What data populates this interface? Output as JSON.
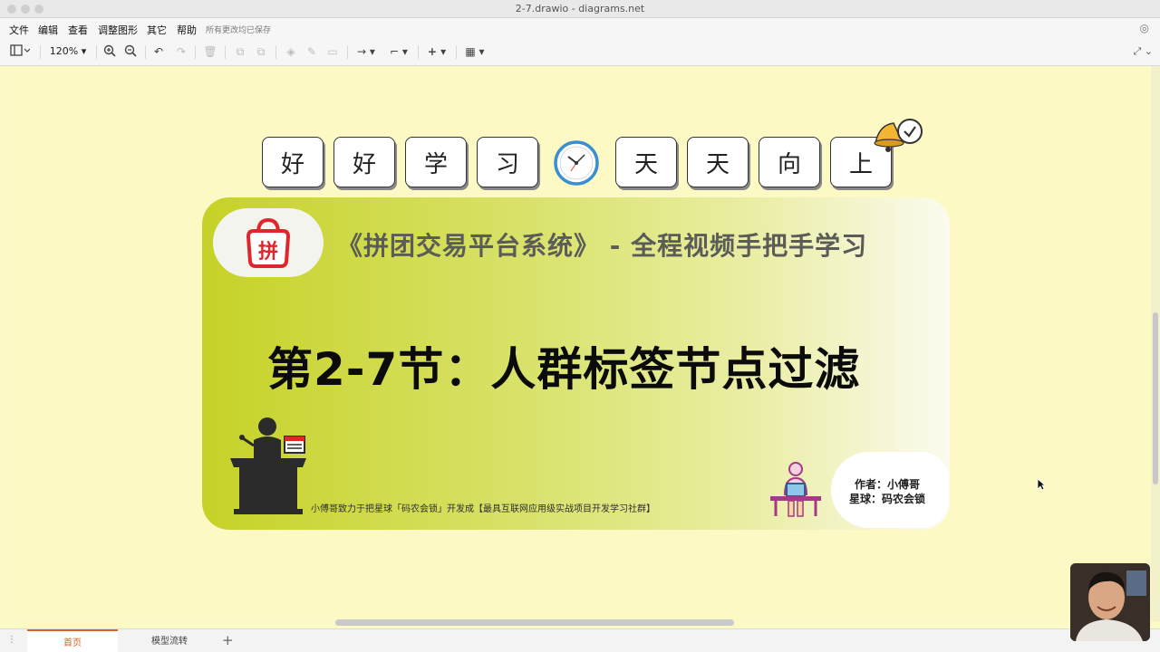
{
  "window": {
    "title": "2-7.drawio - diagrams.net"
  },
  "menubar": {
    "items": [
      "文件",
      "编辑",
      "查看",
      "调整图形",
      "其它",
      "帮助"
    ],
    "status": "所有更改均已保存"
  },
  "toolbar": {
    "zoom": "120%"
  },
  "canvas": {
    "chars_left": [
      "好",
      "好",
      "学",
      "习"
    ],
    "chars_right": [
      "天",
      "天",
      "向",
      "上"
    ],
    "logo_text": "拼",
    "course_title": "《拼团交易平台系统》 - 全程视频手把手学习",
    "lesson_title": "第2-7节：人群标签节点过滤",
    "slogan": "小傅哥致力于把星球「码农会锁」开发成【最具互联网应用级实战项目开发学习社群】",
    "author_line1": "作者：小傅哥",
    "author_line2": "星球：码农会锁"
  },
  "tabs": {
    "items": [
      "首页",
      "模型流转"
    ],
    "active": 0
  },
  "colors": {
    "background": "#fdf9c5",
    "banner_start": "#c6d227",
    "accent_tab": "#d9622b",
    "logo_red": "#e0262d"
  }
}
